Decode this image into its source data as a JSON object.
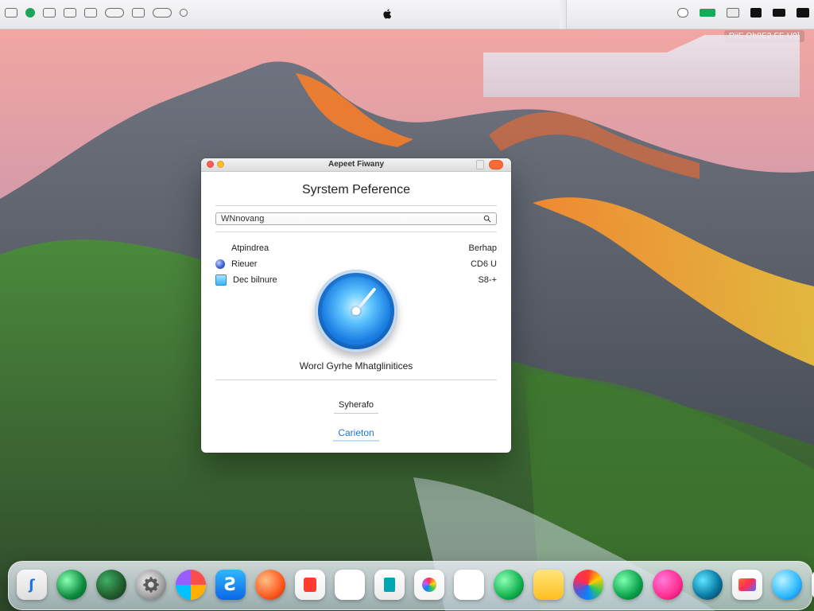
{
  "menubar": {
    "right_clock": "PiiE Ob0E2 FE U9]"
  },
  "dialog": {
    "window_title": "Aepeet Fiwany",
    "pref_title": "Syrstem Peference",
    "search": {
      "value": "WNnovang"
    },
    "list": [
      {
        "label": "Atpindrea",
        "value": "Berhap",
        "icon": ""
      },
      {
        "label": "Rieuer",
        "value": "CD6 U",
        "icon": "blue-circle"
      },
      {
        "label": "Dec bilnure",
        "value": "S8-+",
        "icon": "square"
      }
    ],
    "center_caption": "Worcl Gyrhe Mhatglinitices",
    "small_label": "Syherafo",
    "cancel_label": "Carieton"
  },
  "dock": {
    "apps": [
      {
        "icon": "finder-icon"
      },
      {
        "icon": "green-circle-icon"
      },
      {
        "icon": "darkgreen-circle-icon"
      },
      {
        "icon": "gear-icon"
      },
      {
        "icon": "photos-icon"
      },
      {
        "icon": "appstore-icon"
      },
      {
        "icon": "orange-app-icon"
      },
      {
        "icon": "red-square-icon"
      },
      {
        "icon": "blank-app-icon"
      },
      {
        "icon": "teal-square-icon"
      },
      {
        "icon": "candy-icon"
      },
      {
        "icon": "white-square-icon"
      },
      {
        "icon": "green-chat-icon"
      },
      {
        "icon": "yellow-notes-icon"
      },
      {
        "icon": "color-wheel-icon"
      },
      {
        "icon": "green-leaf-icon"
      },
      {
        "icon": "pink-circle-icon"
      },
      {
        "icon": "dark-cyan-circle-icon"
      },
      {
        "icon": "photos-edit-icon"
      },
      {
        "icon": "blue-ball-icon"
      },
      {
        "icon": "preview-icon"
      }
    ]
  }
}
